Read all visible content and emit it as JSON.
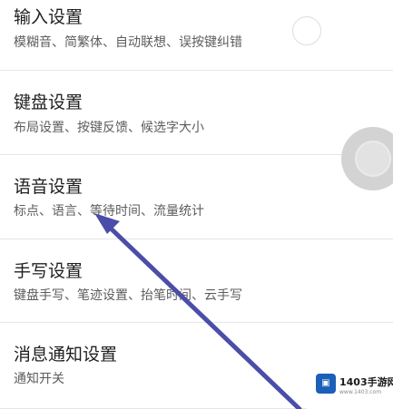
{
  "settings": {
    "items": [
      {
        "title": "输入设置",
        "subtitle": "模糊音、简繁体、自动联想、误按键纠错"
      },
      {
        "title": "键盘设置",
        "subtitle": "布局设置、按键反馈、候选字大小"
      },
      {
        "title": "语音设置",
        "subtitle": "标点、语言、等待时间、流量统计"
      },
      {
        "title": "手写设置",
        "subtitle": "键盘手写、笔迹设置、抬笔时间、云手写"
      },
      {
        "title": "消息通知设置",
        "subtitle": "通知开关"
      }
    ]
  },
  "watermark": {
    "brand": "1403手游网",
    "url": "www.1403.com"
  },
  "colors": {
    "arrow": "#4b4ea8",
    "background": "#f1f1f1",
    "item_background": "#ffffff"
  }
}
